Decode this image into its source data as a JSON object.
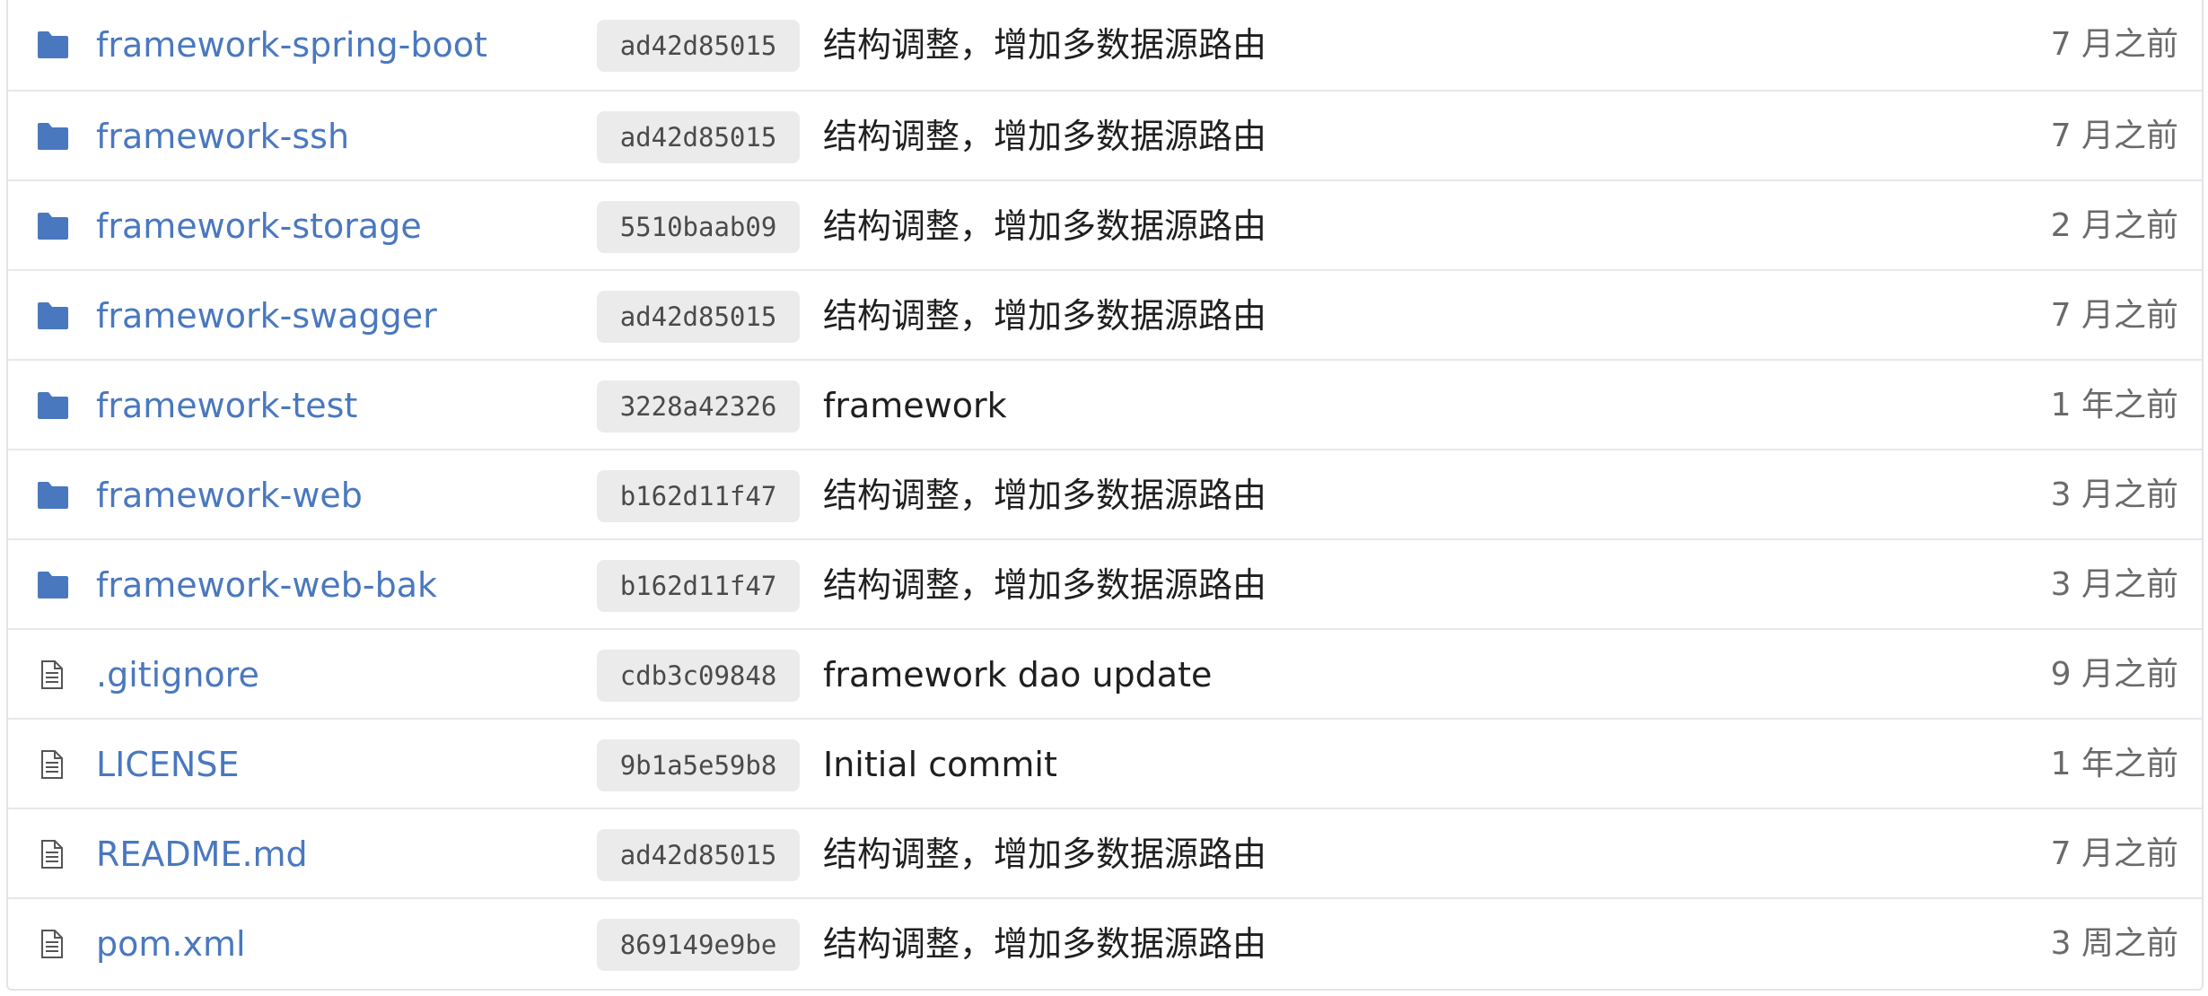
{
  "colors": {
    "link": "#4a78bf",
    "folder_icon": "#4a78bf",
    "file_icon": "#555555",
    "sha_bg": "#ebebeb",
    "message": "#1f1f1f",
    "age": "#6a6a6a",
    "border": "#e1e4e8"
  },
  "files": [
    {
      "type": "folder",
      "icon": "folder-icon",
      "name": "framework-spring-boot",
      "sha": "ad42d85015",
      "message": "结构调整，增加多数据源路由",
      "age": "7 月之前"
    },
    {
      "type": "folder",
      "icon": "folder-icon",
      "name": "framework-ssh",
      "sha": "ad42d85015",
      "message": "结构调整，增加多数据源路由",
      "age": "7 月之前"
    },
    {
      "type": "folder",
      "icon": "folder-icon",
      "name": "framework-storage",
      "sha": "5510baab09",
      "message": "结构调整，增加多数据源路由",
      "age": "2 月之前"
    },
    {
      "type": "folder",
      "icon": "folder-icon",
      "name": "framework-swagger",
      "sha": "ad42d85015",
      "message": "结构调整，增加多数据源路由",
      "age": "7 月之前"
    },
    {
      "type": "folder",
      "icon": "folder-icon",
      "name": "framework-test",
      "sha": "3228a42326",
      "message": "framework",
      "age": "1 年之前"
    },
    {
      "type": "folder",
      "icon": "folder-icon",
      "name": "framework-web",
      "sha": "b162d11f47",
      "message": "结构调整，增加多数据源路由",
      "age": "3 月之前"
    },
    {
      "type": "folder",
      "icon": "folder-icon",
      "name": "framework-web-bak",
      "sha": "b162d11f47",
      "message": "结构调整，增加多数据源路由",
      "age": "3 月之前"
    },
    {
      "type": "file",
      "icon": "file-icon",
      "name": ".gitignore",
      "sha": "cdb3c09848",
      "message": "framework dao update",
      "age": "9 月之前"
    },
    {
      "type": "file",
      "icon": "file-icon",
      "name": "LICENSE",
      "sha": "9b1a5e59b8",
      "message": "Initial commit",
      "age": "1 年之前"
    },
    {
      "type": "file",
      "icon": "file-icon",
      "name": "README.md",
      "sha": "ad42d85015",
      "message": "结构调整，增加多数据源路由",
      "age": "7 月之前"
    },
    {
      "type": "file",
      "icon": "file-icon",
      "name": "pom.xml",
      "sha": "869149e9be",
      "message": "结构调整，增加多数据源路由",
      "age": "3 周之前"
    }
  ]
}
